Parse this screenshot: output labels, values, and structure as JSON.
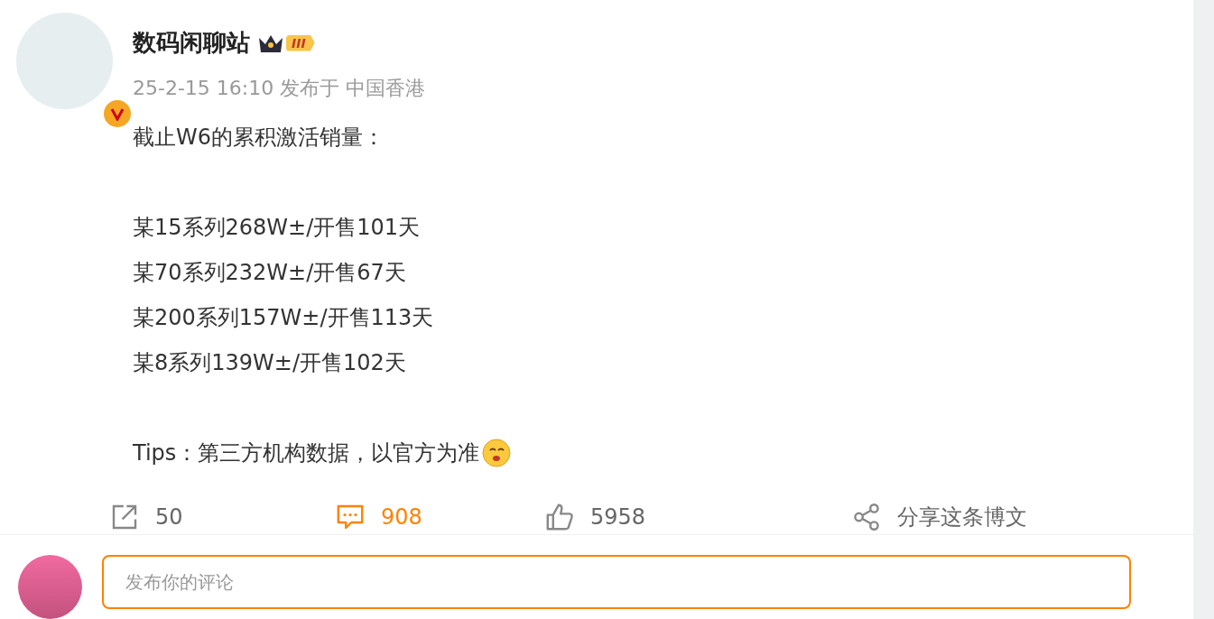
{
  "post": {
    "author": "数码闲聊站",
    "level_badge": "III",
    "verified": true,
    "meta": "25-2-15 16:10 发布于 中国香港",
    "paragraphs": [
      [
        "截止W6的累积激活销量："
      ],
      [
        "某15系列268W±/开售101天",
        "某70系列232W±/开售67天",
        "某200系列157W±/开售113天",
        "某8系列139W±/开售102天"
      ],
      [
        "Tips：第三方机构数据，以官方为准"
      ]
    ]
  },
  "actions": [
    {
      "kind": "repost",
      "label": "50",
      "active": false
    },
    {
      "kind": "comment",
      "label": "908",
      "active": true
    },
    {
      "kind": "like",
      "label": "5958",
      "active": false
    },
    {
      "kind": "share",
      "label": "分享这条博文",
      "active": false
    }
  ],
  "comment_box": {
    "placeholder": "发布你的评论"
  }
}
